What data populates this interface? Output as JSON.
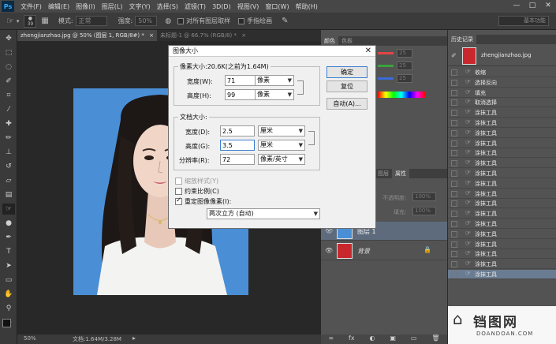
{
  "menubar": {
    "logo": "Ps",
    "items": [
      "文件(F)",
      "编辑(E)",
      "图像(I)",
      "图层(L)",
      "文字(Y)",
      "选择(S)",
      "滤镜(T)",
      "3D(D)",
      "视图(V)",
      "窗口(W)",
      "帮助(H)"
    ],
    "minimize": "—",
    "restore": "□",
    "close": "✕"
  },
  "options_bar": {
    "brush_size": "39",
    "mode_label": "模式:",
    "mode_value": "正常",
    "strength_label": "强度:",
    "strength_value": "50%",
    "sample_all_layers": "对所有图层取样",
    "finger_painting": "手指绘画",
    "workspace": "基本功能"
  },
  "doc_tabs": [
    {
      "label": "zhengjianzhao.jpg @ 50% (图层 1, RGB/8#) *",
      "close": "×",
      "active": true
    },
    {
      "label": "未标题-1 @ 66.7% (RGB/8) *",
      "close": "×",
      "active": false
    }
  ],
  "status_bar": {
    "zoom": "50%",
    "doc_info": "文档:1.64M/3.28M"
  },
  "dialog": {
    "title": "图像大小",
    "close": "✕",
    "pixel_dims": {
      "title": "像素大小:20.6K(之前为1.64M)",
      "width_label": "宽度(W):",
      "width_value": "71",
      "width_unit": "像素",
      "height_label": "高度(H):",
      "height_value": "99",
      "height_unit": "像素"
    },
    "doc_size": {
      "title": "文档大小:",
      "width_label": "宽度(D):",
      "width_value": "2.5",
      "width_unit": "厘米",
      "height_label": "高度(G):",
      "height_value": "3.5",
      "height_unit": "厘米",
      "res_label": "分辨率(R):",
      "res_value": "72",
      "res_unit": "像素/英寸"
    },
    "scale_styles": "缩放样式(Y)",
    "constrain": "约束比例(C)",
    "resample": "重定图像像素(I):",
    "resample_method": "两次立方 (自动)",
    "ok_label": "确定",
    "reset_label": "复位",
    "auto_label": "自动(A)..."
  },
  "mid_panel": {
    "color_tabs": [
      "颜色",
      "色板"
    ],
    "channel_values": [
      "25",
      "25",
      "25"
    ],
    "layer_tab": "图层",
    "properties_tab": "属性",
    "opacity_label": "不透明度:",
    "opacity_value": "100%",
    "fill_label": "填充:",
    "fill_value": "100%",
    "layers": [
      {
        "name": "图层 1",
        "selected": true
      },
      {
        "name": "背景",
        "selected": false,
        "lock": "🔒"
      }
    ],
    "bottom_icons": [
      "∞",
      "fx",
      "◐",
      "▣",
      "▭",
      "🗑"
    ]
  },
  "history": {
    "title": "历史记录",
    "snapshot": "zhengjianzhao.jpg",
    "items": [
      "收缩",
      "选择反向",
      "填充",
      "取消选择",
      "涂抹工具",
      "涂抹工具",
      "涂抹工具",
      "涂抹工具",
      "涂抹工具",
      "涂抹工具",
      "涂抹工具",
      "涂抹工具",
      "涂抹工具",
      "涂抹工具",
      "涂抹工具",
      "涂抹工具",
      "涂抹工具",
      "涂抹工具",
      "涂抹工具",
      "涂抹工具",
      "涂抹工具"
    ]
  },
  "watermark": {
    "brand": "铛图网",
    "domain": "DOANDOAN.COM"
  },
  "colors": {
    "photo_bg": "#4a8fd6",
    "accent": "#3c7fd1"
  }
}
